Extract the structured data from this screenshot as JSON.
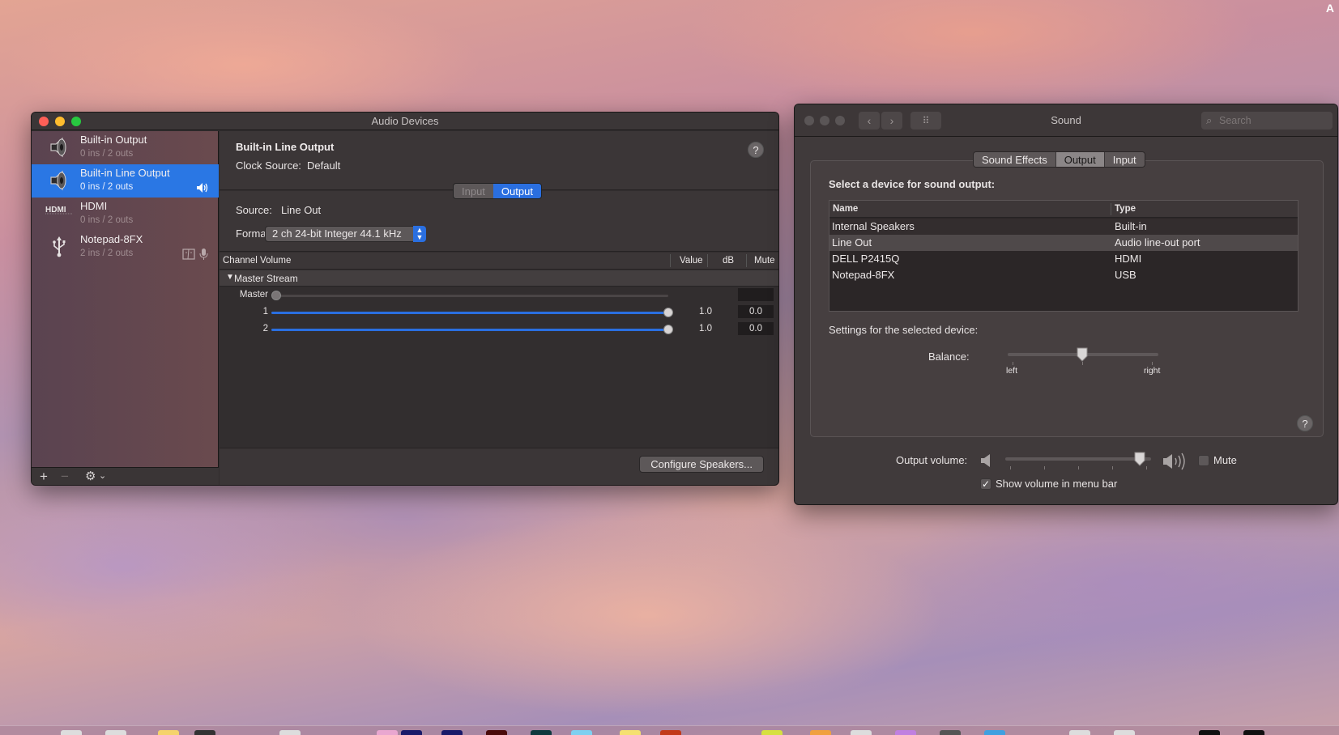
{
  "desktop": {
    "corner_text": "A"
  },
  "audio_devices": {
    "title": "Audio Devices",
    "devices": [
      {
        "name": "Built-in Output",
        "io": "0 ins / 2 outs",
        "icon": "speaker-icon",
        "selected": false
      },
      {
        "name": "Built-in Line Output",
        "io": "0 ins / 2 outs",
        "icon": "speaker-icon",
        "selected": true,
        "badges": [
          "output-volume-icon"
        ]
      },
      {
        "name": "HDMI",
        "io": "0 ins / 2 outs",
        "icon": "hdmi-icon",
        "selected": false
      },
      {
        "name": "Notepad-8FX",
        "io": "2 ins / 2 outs",
        "icon": "usb-icon",
        "selected": false,
        "badges": [
          "finder-icon",
          "microphone-icon"
        ]
      }
    ],
    "footer": {
      "add": "+",
      "remove": "−",
      "gear": "⚙",
      "gear_menu": "⌄"
    },
    "detail": {
      "device_title": "Built-in Line Output",
      "clock_source_label": "Clock Source:",
      "clock_source_value": "Default",
      "help": "?",
      "tabs": [
        {
          "label": "Input",
          "active": false
        },
        {
          "label": "Output",
          "active": true
        }
      ],
      "source_label": "Source:",
      "source_value": "Line Out",
      "format_label": "Format:",
      "format_value": "2 ch 24-bit Integer 44.1 kHz",
      "volume_table": {
        "headers": {
          "channel": "Channel Volume",
          "value": "Value",
          "db": "dB",
          "mute": "Mute"
        },
        "stream": "Master Stream",
        "channels": [
          {
            "label": "Master",
            "level": 0.0,
            "value": "",
            "db": "",
            "mute": false,
            "enabled": false
          },
          {
            "label": "1",
            "level": 1.0,
            "value": "1.0",
            "db": "0.0",
            "mute": false,
            "enabled": true
          },
          {
            "label": "2",
            "level": 1.0,
            "value": "1.0",
            "db": "0.0",
            "mute": false,
            "enabled": true
          }
        ]
      },
      "configure_button": "Configure Speakers..."
    }
  },
  "sound": {
    "title": "Sound",
    "nav": {
      "back": "‹",
      "forward": "›",
      "grid": "⠿"
    },
    "search_placeholder": "Search",
    "tabs": [
      {
        "label": "Sound Effects",
        "active": false
      },
      {
        "label": "Output",
        "active": true
      },
      {
        "label": "Input",
        "active": false
      }
    ],
    "select_heading": "Select a device for sound output:",
    "table": {
      "headers": {
        "name": "Name",
        "type": "Type"
      },
      "rows": [
        {
          "name": "Internal Speakers",
          "type": "Built-in"
        },
        {
          "name": "Line Out",
          "type": "Audio line-out port",
          "selected": true
        },
        {
          "name": "DELL P2415Q",
          "type": "HDMI"
        },
        {
          "name": "Notepad-8FX",
          "type": "USB"
        }
      ]
    },
    "settings_heading": "Settings for the selected device:",
    "balance": {
      "label": "Balance:",
      "left": "left",
      "right": "right",
      "value": 0.5
    },
    "help": "?",
    "output_volume": {
      "label": "Output volume:",
      "value": 0.95
    },
    "mute": {
      "label": "Mute",
      "checked": false
    },
    "show_volume": {
      "label": "Show volume in menu bar",
      "checked": true
    }
  }
}
